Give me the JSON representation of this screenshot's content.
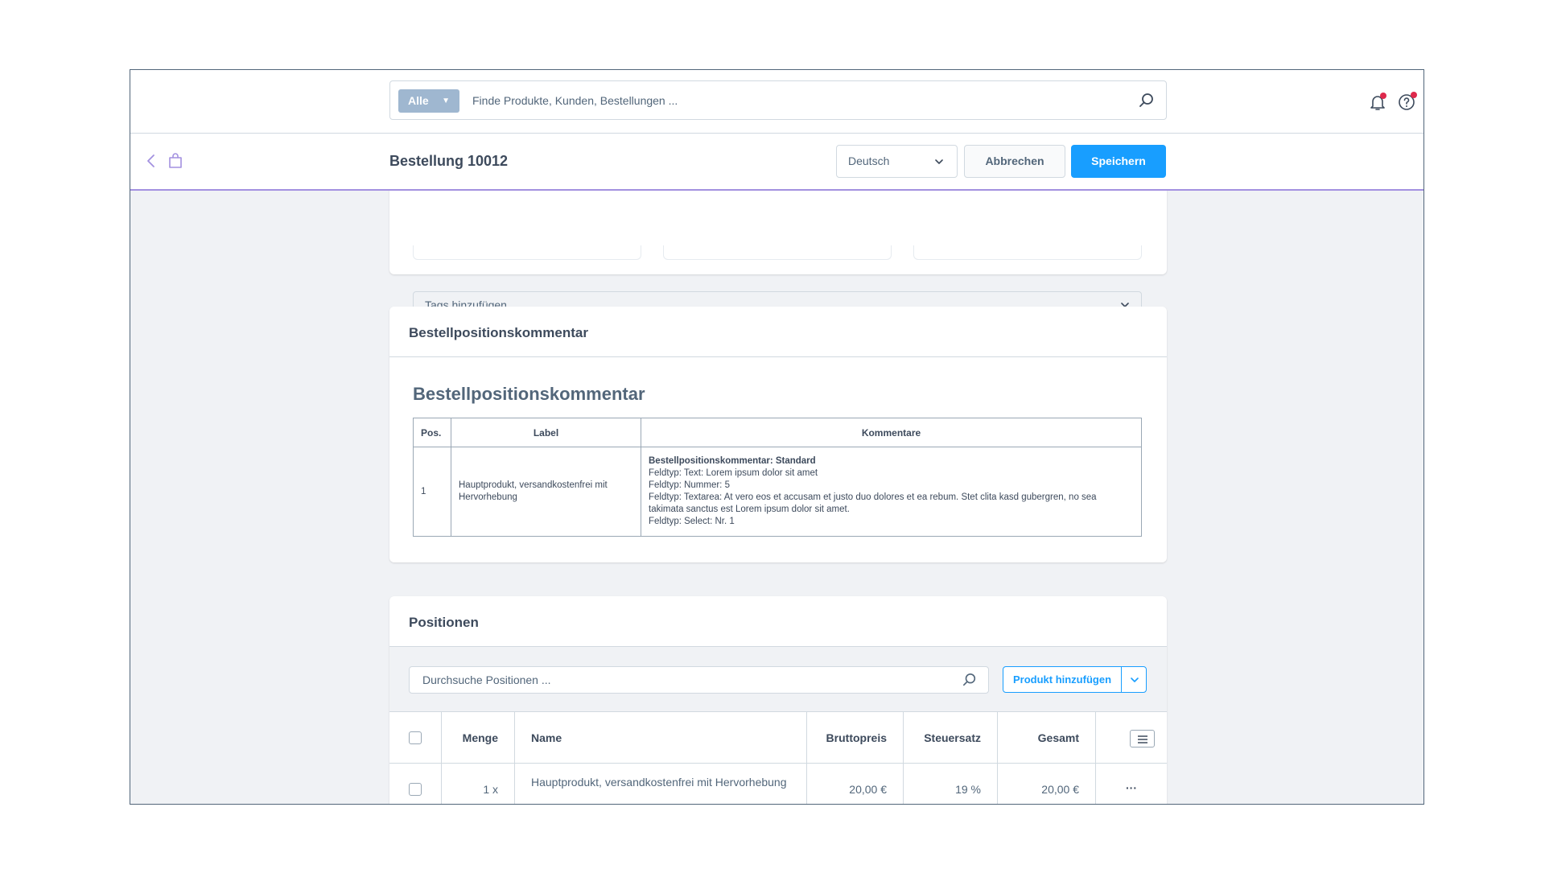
{
  "search": {
    "type_label": "Alle",
    "placeholder": "Finde Produkte, Kunden, Bestellungen ..."
  },
  "header": {
    "title": "Bestellung 10012",
    "language": "Deutsch",
    "cancel_label": "Abbrechen",
    "save_label": "Speichern"
  },
  "status_card": {
    "tags_placeholder": "Tags hinzufügen ..."
  },
  "comment_card": {
    "title": "Bestellpositionskommentar",
    "heading": "Bestellpositionskommentar",
    "columns": [
      "Pos.",
      "Label",
      "Kommentare"
    ],
    "rows": [
      {
        "pos": "1",
        "label": "Hauptprodukt, versandkostenfrei mit Hervorhebung",
        "comment_title": "Bestellpositionskommentar: Standard",
        "comment_lines": [
          "Feldtyp: Text: Lorem ipsum dolor sit amet",
          "Feldtyp: Nummer: 5",
          "Feldtyp: Textarea: At vero eos et accusam et justo duo dolores et ea rebum. Stet clita kasd gubergren, no sea takimata sanctus est Lorem ipsum dolor sit amet.",
          "Feldtyp: Select: Nr. 1"
        ]
      }
    ]
  },
  "positions_card": {
    "title": "Positionen",
    "search_placeholder": "Durchsuche Positionen ...",
    "add_product_label": "Produkt hinzufügen",
    "columns": {
      "quantity": "Menge",
      "name": "Name",
      "gross_price": "Bruttopreis",
      "tax_rate": "Steuersatz",
      "total": "Gesamt"
    },
    "rows": [
      {
        "quantity": "1 x",
        "name": "Hauptprodukt, versandkostenfrei mit Hervorhebung",
        "gross_price": "20,00 €",
        "tax_rate": "19 %",
        "total": "20,00 €",
        "actions": "···"
      }
    ]
  },
  "colors": {
    "primary": "#189eff",
    "header_border": "#a391e0",
    "notification_dot": "#de294c"
  }
}
